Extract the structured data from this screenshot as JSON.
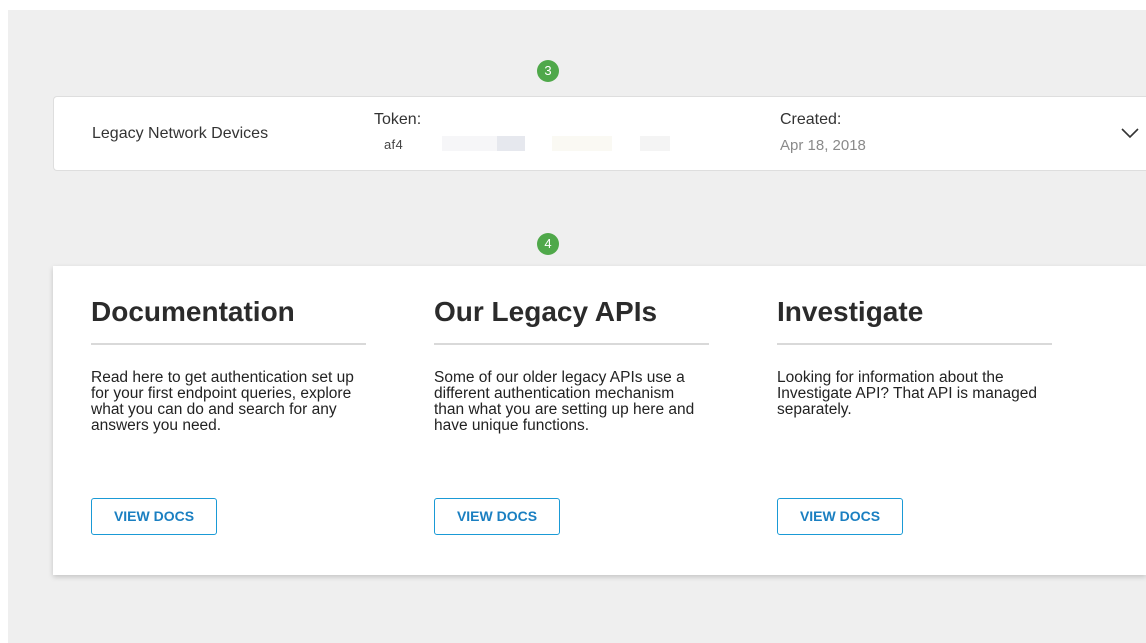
{
  "steps": {
    "step_a": "3",
    "step_b": "4"
  },
  "key_card": {
    "name": "Legacy Network Devices",
    "token_label": "Token:",
    "token_value": "af4",
    "created_label": "Created:",
    "created_value": "Apr 18, 2018",
    "expand_icon": "chevron-down-icon"
  },
  "docs": [
    {
      "title": "Documentation",
      "body": "Read here to get authentication set up for your first endpoint queries, explore what you can do and search for any answers you need.",
      "button": "VIEW DOCS"
    },
    {
      "title": "Our Legacy APIs",
      "body": "Some of our older legacy APIs use a different authentication mechanism than what you are setting up here and have unique functions.",
      "button": "VIEW DOCS"
    },
    {
      "title": "Investigate",
      "body": "Looking for information about the Investigate API? That API is managed separately.",
      "button": "VIEW DOCS"
    }
  ],
  "colors": {
    "step_badge": "#4fa84a",
    "button_accent": "#1a9ad6",
    "background": "#efefef"
  }
}
